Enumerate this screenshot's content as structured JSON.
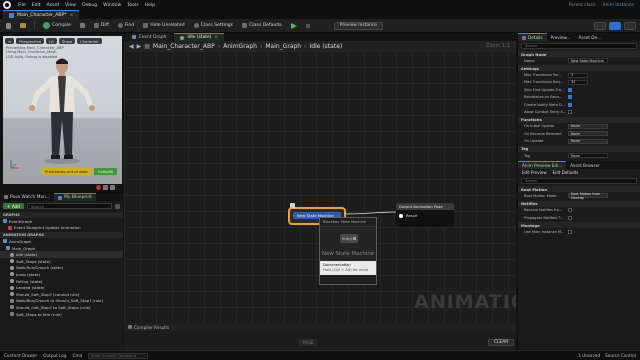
{
  "menubar": {
    "items": [
      "File",
      "Edit",
      "Asset",
      "View",
      "Debug",
      "Window",
      "Tools",
      "Help"
    ],
    "parent_label": "Parent class:",
    "parent_name": "Anim Instance"
  },
  "doc_tab": {
    "label": "Main_Character_ABP*"
  },
  "toolbar": {
    "compile": "Compile",
    "save": "Save",
    "diff": "Diff",
    "find": "Find",
    "hide_unrelated": "Hide Unrelated",
    "class_settings": "Class Settings",
    "class_defaults": "Class Defaults",
    "preview_instance": "Preview Instance"
  },
  "viewport": {
    "perspective": "Perspective",
    "lit": "Lit",
    "show": "Show",
    "character": "Character",
    "info_lines": [
      "Previewing Main_Character_ABP",
      "Using Main_Character_Mesh",
      "LOD Auto, Debug is disabled"
    ],
    "preview_bar": "Previewing out of date",
    "compile_bar": "Compile"
  },
  "blueprint": {
    "tab_browse": "Pose Watch Man...",
    "tab_blueprint": "My Blueprint",
    "add_label": "+ Add",
    "search_placeholder": "Search",
    "section_graphs": "GRAPHS",
    "event_graph": "EventGraph",
    "event_update": "Event Blueprint Update Animation",
    "section_anim": "ANIMATION GRAPHS",
    "anim_graph": "AnimGraph",
    "main_graph": "Main_Graph",
    "states": [
      "Idle (state)",
      "Soft_Stops (state)",
      "Walk/Run/Crouch (state)",
      "Jump (state)",
      "Falling (state)",
      "Landed (state)",
      "Should_Soft_Stop? (conduit rule)",
      "Walk/Run/Crouch to Should_Soft_Stop? (rule)",
      "Should_Soft_Stop? to Soft_Stops (rule)",
      "Soft_Stops to Idle (rule)"
    ]
  },
  "graph": {
    "tab_event": "Event Graph",
    "tab_idle": "Idle (state)",
    "crumbs": [
      "Main_Character_ABP",
      "AnimGraph",
      "Main_Graph",
      "Idle (state)"
    ],
    "zoom": "Zoom 1:1",
    "watermark": "ANIMATION",
    "state_machine_label": "New State Machine",
    "output_node_title": "Output Animation Pose",
    "output_pin": "Result",
    "ctx_header": "Blackbox State Machine",
    "ctx_entry": "Entry",
    "ctx_big": "New State Machine",
    "tooltip_title": "Documentation",
    "tooltip_sub": "Hold (Ctrl + Alt) for more",
    "compiler_tab": "Compiler Results",
    "page_btn": "PAGE",
    "clear_btn": "CLEAR"
  },
  "details": {
    "tab_details": "Details",
    "tab_preview": "Preview...",
    "tab_asset": "Asset De...",
    "search_placeholder": "Search",
    "section_graph_node": "Graph Node",
    "name_label": "Name",
    "name_value": "New State Machine",
    "section_settings": "Settings",
    "max_transitions_label": "Max Transitions Per...",
    "max_transitions_value": "3",
    "max_transitions_req_label": "Max Transitions Req...",
    "max_transitions_req_value": "32",
    "skip_first_label": "Skip First Update Tra...",
    "reinit_label": "Reinitialize on Beco...",
    "create_notify_label": "Create Notify Meta D...",
    "allow_conduit_label": "Allow Conduit Entry S...",
    "section_functions": "Functions",
    "on_initial_label": "On Initial Update",
    "on_become_label": "On Become Relevant",
    "on_update_label": "On Update",
    "none_value": "None",
    "section_tag": "Tag",
    "tag_label": "Tag",
    "tag_value": "None",
    "anim_tab": "Anim Preview Edi...",
    "asset_browser_tab": "Asset Browser",
    "edit_preview_tab": "Edit Preview",
    "edit_defaults_tab": "Edit Defaults",
    "section_root_motion": "Root Motion",
    "root_motion_mode_label": "Root Motion Mode",
    "root_motion_mode_value": "Root Motion from Montag",
    "section_notifies": "Notifies",
    "receive_notifies_label": "Receive Notifies fro...",
    "propagate_label": "Propagate Notifies T...",
    "section_montage": "Montage",
    "use_main_label": "Use Main Instance M..."
  },
  "statusbar": {
    "content_drawer": "Content Drawer",
    "output_log": "Output Log",
    "cmd": "Cmd",
    "cmd_placeholder": "Enter Console Command",
    "unsaved": "1 Unsaved",
    "source_control": "Source Control"
  },
  "colors": {
    "accent": "#2673d6",
    "state_border": "#f0a321",
    "compile_green": "#45c34b"
  }
}
